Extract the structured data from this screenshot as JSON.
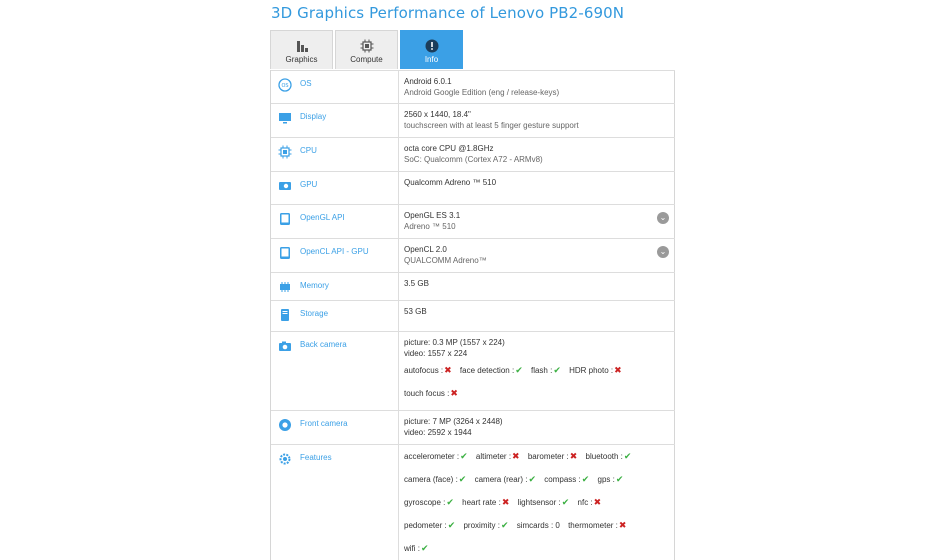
{
  "title": "3D Graphics Performance of Lenovo PB2-690N",
  "tabs": [
    {
      "label": "Graphics",
      "icon": "bar-chart-icon",
      "active": false
    },
    {
      "label": "Compute",
      "icon": "chip-icon",
      "active": false
    },
    {
      "label": "Info",
      "icon": "info-icon",
      "active": true
    }
  ],
  "rows": {
    "os": {
      "label": "OS",
      "icon": "os-icon",
      "line1": "Android 6.0.1",
      "line2": "Android Google Edition (eng / release-keys)"
    },
    "display": {
      "label": "Display",
      "icon": "display-icon",
      "line1": "2560 x 1440, 18.4\"",
      "line2": "touchscreen with at least 5 finger gesture support"
    },
    "cpu": {
      "label": "CPU",
      "icon": "cpu-icon",
      "line1": "octa core CPU @1.8GHz",
      "line2": "SoC: Qualcomm (Cortex A72 - ARMv8)"
    },
    "gpu": {
      "label": "GPU",
      "icon": "gpu-icon",
      "line1": "Qualcomm Adreno ™ 510"
    },
    "opengl": {
      "label": "OpenGL API",
      "icon": "opengl-icon",
      "line1": "OpenGL ES 3.1",
      "line2": "Adreno ™ 510"
    },
    "opencl": {
      "label": "OpenCL API - GPU",
      "icon": "opencl-icon",
      "line1": "OpenCL 2.0",
      "line2": "QUALCOMM Adreno™"
    },
    "memory": {
      "label": "Memory",
      "icon": "memory-icon",
      "line1": "3.5 GB"
    },
    "storage": {
      "label": "Storage",
      "icon": "storage-icon",
      "line1": "53 GB"
    },
    "back_camera": {
      "label": "Back camera",
      "icon": "camera-icon",
      "line1": "picture: 0.3 MP (1557 x 224)",
      "line2": "video: 1557 x 224",
      "features": [
        [
          {
            "name": "autofocus :",
            "ok": false
          },
          {
            "name": "face detection :",
            "ok": true
          },
          {
            "name": "flash :",
            "ok": true
          },
          {
            "name": "HDR photo :",
            "ok": false
          }
        ],
        [
          {
            "name": "touch focus :",
            "ok": false
          }
        ]
      ]
    },
    "front_camera": {
      "label": "Front camera",
      "icon": "front-camera-icon",
      "line1": "picture: 7 MP (3264 x 2448)",
      "line2": "video: 2592 x 1944"
    },
    "features": {
      "label": "Features",
      "icon": "gear-icon",
      "lines": [
        [
          {
            "name": "accelerometer :",
            "ok": true
          },
          {
            "name": "altimeter :",
            "ok": false
          },
          {
            "name": "barometer :",
            "ok": false
          },
          {
            "name": "bluetooth :",
            "ok": true
          }
        ],
        [
          {
            "name": "camera (face) :",
            "ok": true
          },
          {
            "name": "camera (rear) :",
            "ok": true
          },
          {
            "name": "compass :",
            "ok": true
          },
          {
            "name": "gps :",
            "ok": true
          }
        ],
        [
          {
            "name": "gyroscope :",
            "ok": true
          },
          {
            "name": "heart rate :",
            "ok": false
          },
          {
            "name": "lightsensor :",
            "ok": true
          },
          {
            "name": "nfc :",
            "ok": false
          }
        ],
        [
          {
            "name": "pedometer :",
            "ok": true
          },
          {
            "name": "proximity :",
            "ok": true
          },
          {
            "name": "simcards : 0",
            "ok": null
          },
          {
            "name": "thermometer :",
            "ok": false
          }
        ],
        [
          {
            "name": "wifi :",
            "ok": true
          }
        ]
      ]
    }
  },
  "marks": {
    "ok": "✔",
    "no": "✖"
  },
  "colors": {
    "accent": "#3ba0e6",
    "title": "#3399dd",
    "ok": "#3cb043",
    "no": "#cc2222"
  }
}
